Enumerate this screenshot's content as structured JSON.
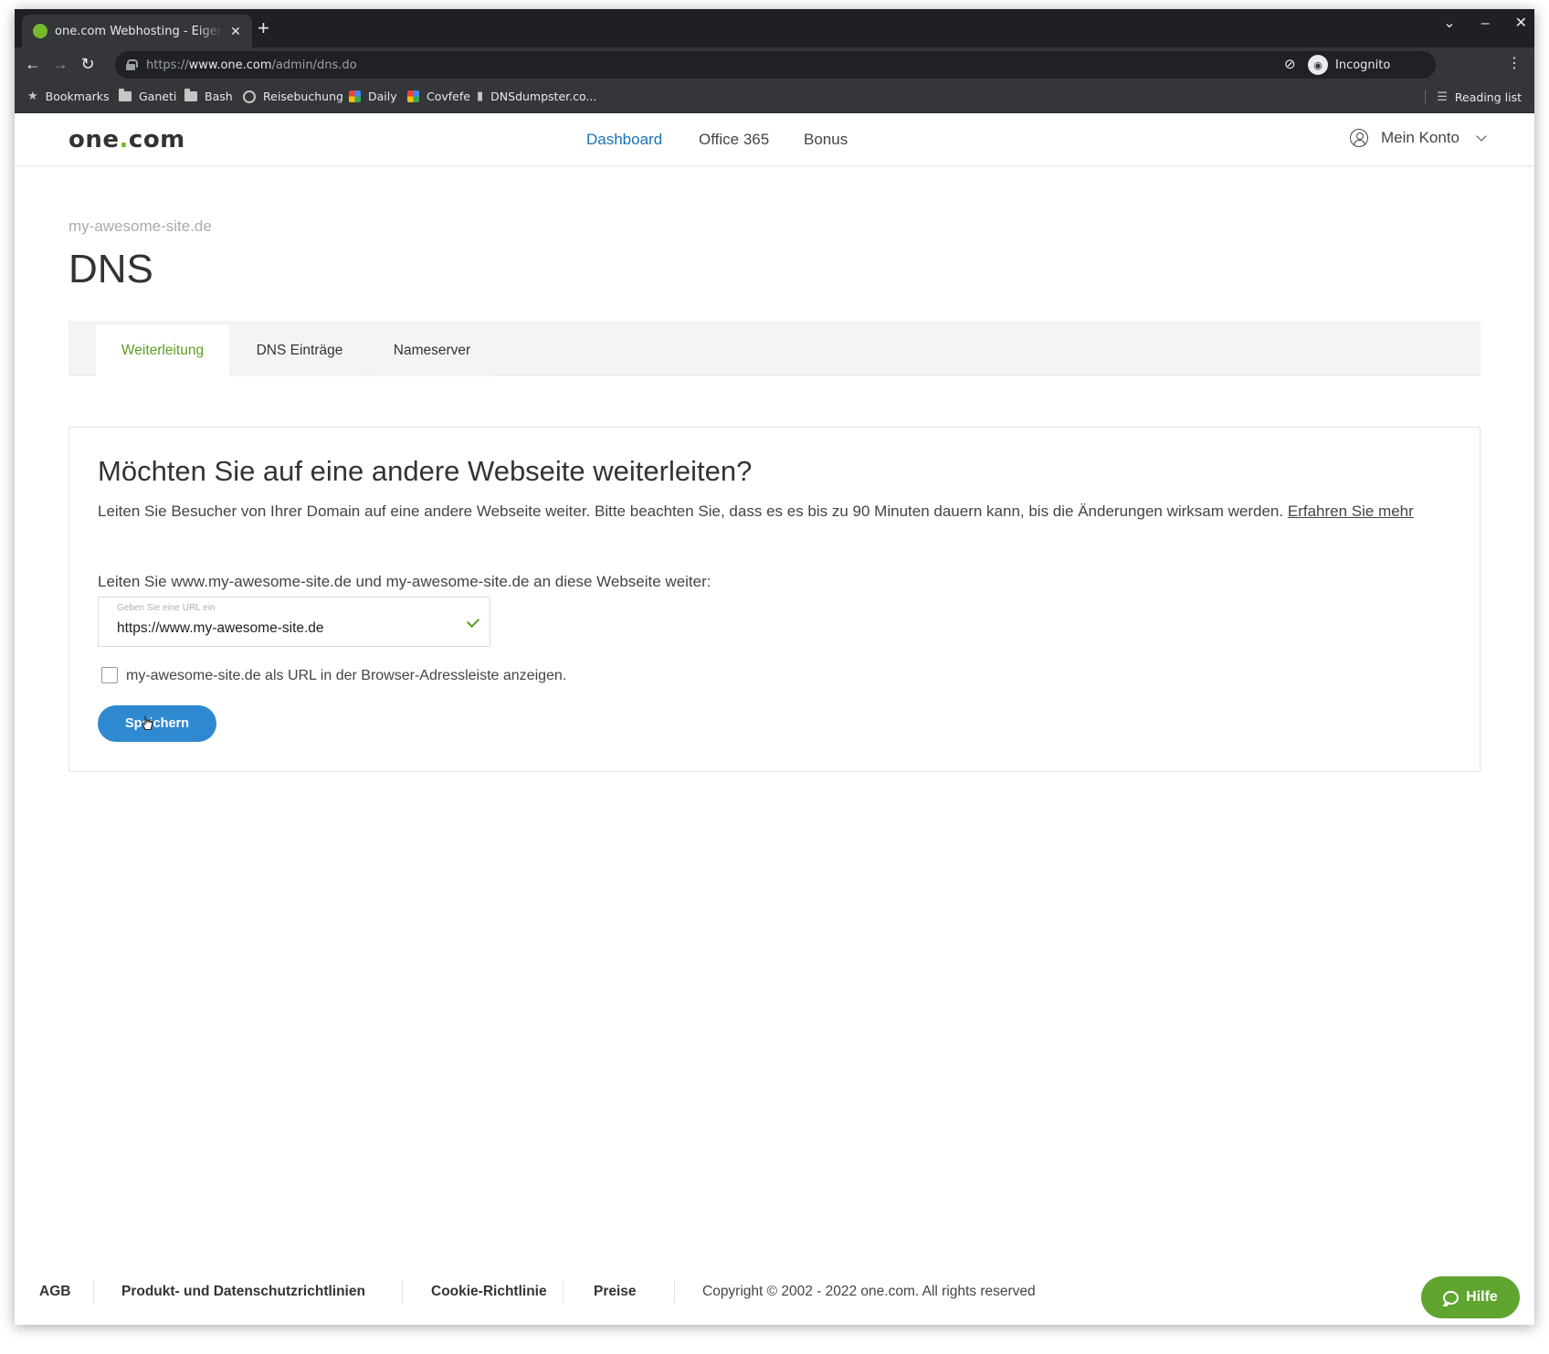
{
  "browser": {
    "tab_title": "one.com Webhosting - Eigene Domain",
    "url_scheme": "https://",
    "url_host": "www.one.com",
    "url_path": "/admin/dns.do",
    "incognito_label": "Incognito",
    "bookmarks": [
      {
        "label": "Bookmarks",
        "icon": "star-icon"
      },
      {
        "label": "Ganeti",
        "icon": "folder-icon"
      },
      {
        "label": "Bash",
        "icon": "folder-icon"
      },
      {
        "label": "Reisebuchung",
        "icon": "globe-icon"
      },
      {
        "label": "Daily",
        "icon": "calendar-icon"
      },
      {
        "label": "Covfefe",
        "icon": "calendar-icon"
      },
      {
        "label": "DNSdumpster.co...",
        "icon": "site-icon"
      }
    ],
    "reading_list_label": "Reading list"
  },
  "header": {
    "logo_text": "one",
    "logo_dot": ".",
    "logo_suffix": "com",
    "nav": [
      {
        "label": "Dashboard",
        "active": true
      },
      {
        "label": "Office 365",
        "active": false
      },
      {
        "label": "Bonus",
        "active": false
      }
    ],
    "account_label": "Mein Konto"
  },
  "main": {
    "domain": "my-awesome-site.de",
    "title": "DNS",
    "tabs": [
      {
        "label": "Weiterleitung",
        "active": true
      },
      {
        "label": "DNS Einträge",
        "active": false
      },
      {
        "label": "Nameserver",
        "active": false
      }
    ],
    "card": {
      "title": "Möchten Sie auf eine andere Webseite weiterleiten?",
      "description": "Leiten Sie Besucher von Ihrer Domain auf eine andere Webseite weiter. Bitte beachten Sie, dass es es bis zu 90 Minuten dauern kann, bis die Änderungen wirksam werden.",
      "learn_more": "Erfahren Sie mehr",
      "instruction": "Leiten Sie www.my-awesome-site.de und my-awesome-site.de an diese Webseite weiter:",
      "url_field_label": "Geben Sie eine URL ein",
      "url_value": "https://www.my-awesome-site.de",
      "checkbox_label": "my-awesome-site.de als URL in der Browser-Adressleiste anzeigen.",
      "checkbox_checked": false,
      "save_label": "Speichern"
    }
  },
  "footer": {
    "links": [
      "AGB",
      "Produkt- und Datenschutzrichtlinien",
      "Cookie-Richtlinie",
      "Preise"
    ],
    "copyright": "Copyright © 2002 - 2022 one.com. All rights reserved",
    "help_label": "Hilfe"
  },
  "colors": {
    "accent_green": "#76b82a",
    "nav_active_blue": "#1a73b5",
    "button_blue": "#2e89d0",
    "help_green": "#5fa52f"
  }
}
